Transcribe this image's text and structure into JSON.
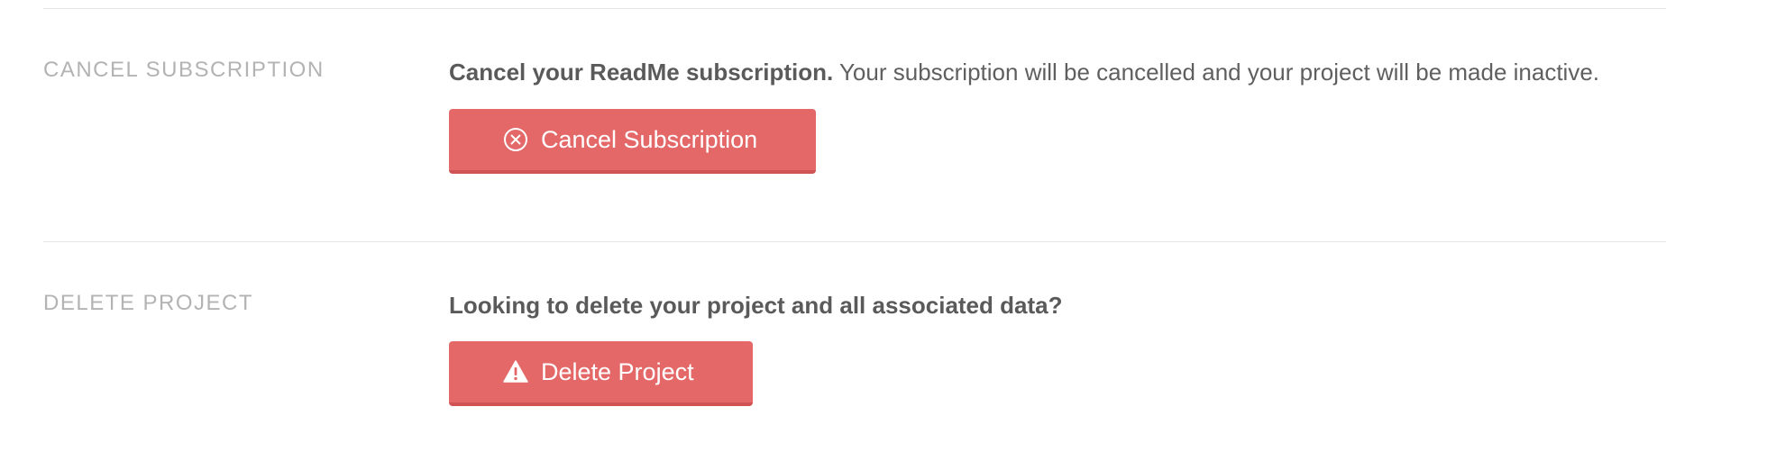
{
  "cancel_section": {
    "heading": "CANCEL SUBSCRIPTION",
    "description_bold": "Cancel your ReadMe subscription.",
    "description_rest": " Your subscription will be cancelled and your project will be made inactive.",
    "button_label": "Cancel Subscription",
    "button_icon": "circle-x-icon"
  },
  "delete_section": {
    "heading": "DELETE PROJECT",
    "description_bold": "Looking to delete your project and all associated data?",
    "button_label": "Delete Project",
    "button_icon": "warning-triangle-icon"
  },
  "colors": {
    "danger": "#e46868",
    "danger_border": "#cf5353",
    "heading": "#b3b3b3",
    "text": "#5f5f5f",
    "divider": "#e6e6e6"
  }
}
